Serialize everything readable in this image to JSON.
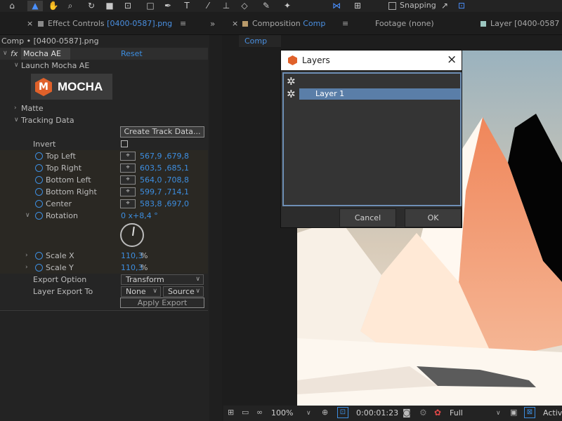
{
  "toolbar": {
    "snapping_label": "Snapping"
  },
  "tabs": {
    "effect_controls_label": "Effect Controls",
    "effect_controls_target": "[0400-0587].png",
    "composition_label": "Composition",
    "composition_target": "Comp",
    "footage_label": "Footage (none)",
    "layer_label": "Layer [0400-0587"
  },
  "effect_panel": {
    "breadcrumb": "Comp • [0400-0587].png",
    "fx_symbol": "fx",
    "effect_name": "Mocha AE",
    "reset_label": "Reset",
    "launch_label": "Launch Mocha AE",
    "logo_text": "MOCHA",
    "logo_letter": "M",
    "matte_label": "Matte",
    "tracking_data_label": "Tracking Data",
    "create_track_label": "Create Track Data...",
    "invert_label": "Invert",
    "points": [
      {
        "label": "Top Left",
        "value": "567,9 ,679,8"
      },
      {
        "label": "Top Right",
        "value": "603,5 ,685,1"
      },
      {
        "label": "Bottom Left",
        "value": "564,0 ,708,8"
      },
      {
        "label": "Bottom Right",
        "value": "599,7 ,714,1"
      },
      {
        "label": "Center",
        "value": "583,8 ,697,0"
      }
    ],
    "rotation_label": "Rotation",
    "rotation_value": "0 x+8,4 °",
    "scale_x_label": "Scale X",
    "scale_x_value": "110,3",
    "scale_y_label": "Scale Y",
    "scale_y_value": "110,3",
    "percent": "%",
    "export_option_label": "Export Option",
    "export_option_value": "Transform",
    "layer_export_label": "Layer Export To",
    "layer_export_value": "None",
    "source_value": "Source",
    "apply_export_label": "Apply Export"
  },
  "comp": {
    "subtab": "Comp"
  },
  "dialog": {
    "title": "Layers",
    "layer_item": "Layer 1",
    "cancel_label": "Cancel",
    "ok_label": "OK"
  },
  "bottom": {
    "zoom": "100%",
    "timecode": "0:00:01:23",
    "resolution": "Full",
    "active_label": "Activ"
  },
  "colors": {
    "accent": "#3d8ee0",
    "selection": "#5a7ea8",
    "mocha_orange": "#e0612a"
  }
}
